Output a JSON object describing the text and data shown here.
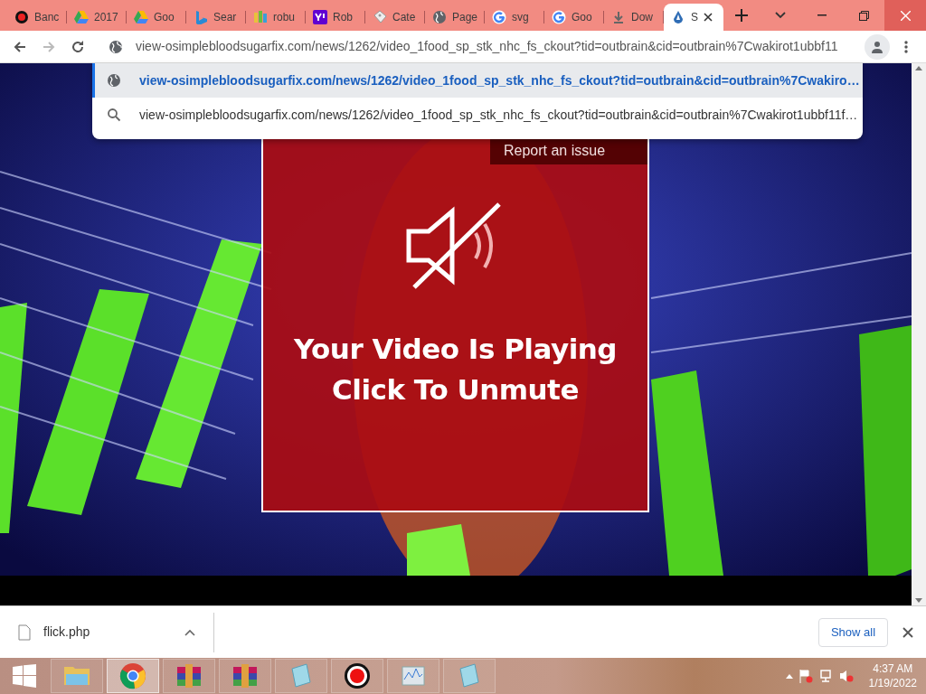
{
  "tabs": [
    {
      "label": "Banc",
      "kind": "record",
      "selected": false
    },
    {
      "label": "2017",
      "kind": "drive",
      "selected": false
    },
    {
      "label": "Goo",
      "kind": "drive",
      "selected": false
    },
    {
      "label": "Sear",
      "kind": "bing",
      "selected": false
    },
    {
      "label": "robu",
      "kind": "bars",
      "selected": false
    },
    {
      "label": "Rob",
      "kind": "yahoo",
      "selected": false
    },
    {
      "label": "Cate",
      "kind": "tag",
      "selected": false
    },
    {
      "label": "Page",
      "kind": "globe",
      "selected": false
    },
    {
      "label": "svg",
      "kind": "google",
      "selected": false
    },
    {
      "label": "Goo",
      "kind": "google",
      "selected": false
    },
    {
      "label": "Dow",
      "kind": "download",
      "selected": false
    },
    {
      "label": "S",
      "kind": "drop",
      "selected": true
    }
  ],
  "address_bar": {
    "value": "view-osimplebloodsugarfix.com/news/1262/video_1food_sp_stk_nhc_fs_ckout?tid=outbrain&cid=outbrain%7Cwakirot1ubbf11"
  },
  "suggestions": [
    {
      "text": "view-osimplebloodsugarfix.com/news/1262/video_1food_sp_stk_nhc_fs_ckout?tid=outbrain&cid=outbrain%7Cwakiro…",
      "kind": "globe",
      "selected": true
    },
    {
      "text": "view-osimplebloodsugarfix.com/news/1262/video_1food_sp_stk_nhc_fs_ckout?tid=outbrain&cid=outbrain%7Cwakirot1ubbf11f…",
      "kind": "search",
      "selected": false
    }
  ],
  "page": {
    "report_link": "Report an issue",
    "headline": "Your Video Is Playing",
    "subline": "Click To Unmute"
  },
  "download_bar": {
    "file": "flick.php",
    "button": "Show all"
  },
  "taskbar": {
    "apps": [
      {
        "kind": "explorer",
        "active": false
      },
      {
        "kind": "chrome",
        "active": true
      },
      {
        "kind": "archive",
        "active": false
      },
      {
        "kind": "archive",
        "active": false
      },
      {
        "kind": "notepad",
        "active": false
      },
      {
        "kind": "record",
        "active": false
      },
      {
        "kind": "monitor",
        "active": false
      },
      {
        "kind": "notepad",
        "active": false
      }
    ],
    "time": "4:37 AM",
    "date": "1/19/2022"
  }
}
